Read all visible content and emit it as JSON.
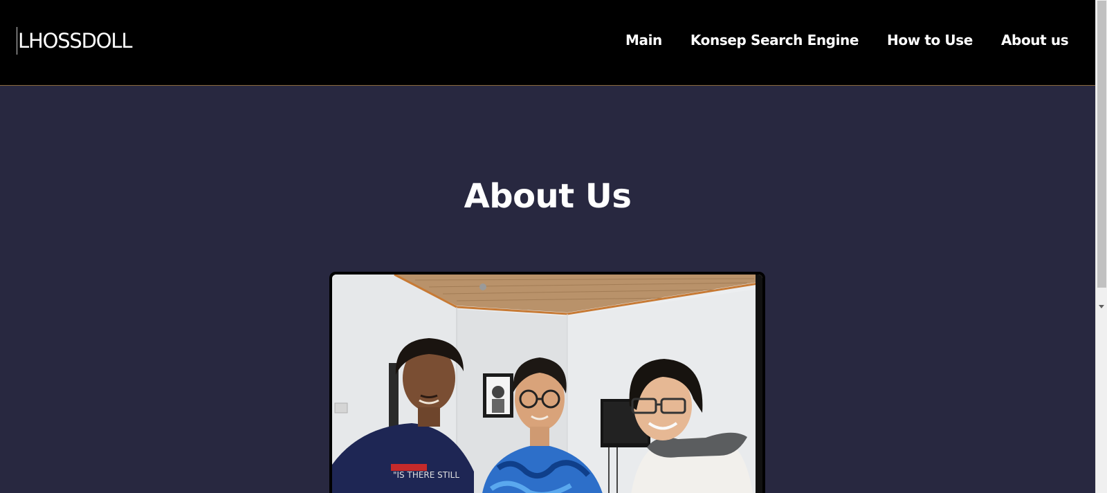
{
  "header": {
    "logo_text": "LHOSSDOLL",
    "nav": [
      {
        "label": "Main"
      },
      {
        "label": "Konsep Search Engine"
      },
      {
        "label": "How to Use"
      },
      {
        "label": "About us"
      }
    ]
  },
  "main": {
    "title": "About Us"
  },
  "colors": {
    "navbar_bg": "#000000",
    "page_bg": "#282840",
    "nav_border": "#8a6a3c",
    "text": "#ffffff"
  }
}
